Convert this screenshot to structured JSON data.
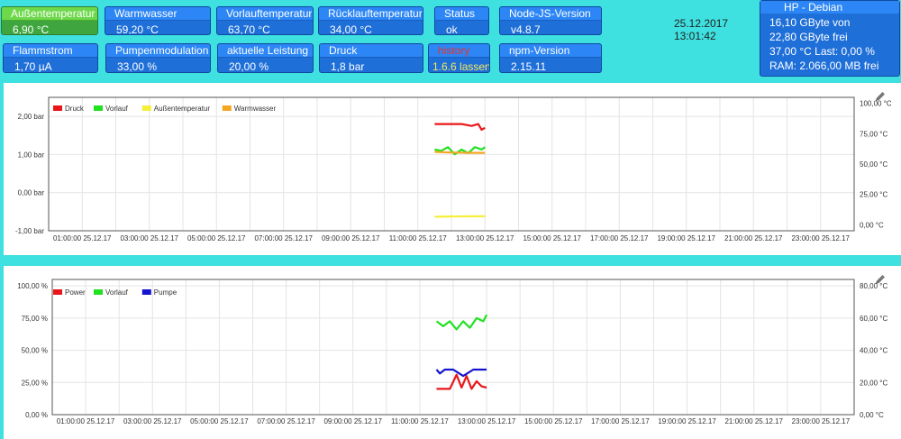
{
  "tiles": [
    {
      "id": "aussen",
      "title": "Außentemperatur",
      "value": "6,90 °C",
      "style": "green"
    },
    {
      "id": "warmwasser",
      "title": "Warmwasser",
      "value": "59,20 °C",
      "style": "blue"
    },
    {
      "id": "vorlauf",
      "title": "Vorlauftemperatur",
      "value": "63,70 °C",
      "style": "blue"
    },
    {
      "id": "ruecklauf",
      "title": "Rücklauftemperatur",
      "value": "34,00 °C",
      "style": "blue"
    },
    {
      "id": "status",
      "title": "Status",
      "value": "ok",
      "style": "blue"
    },
    {
      "id": "node",
      "title": "Node-JS-Version",
      "value": "v4.8.7",
      "style": "blue"
    },
    {
      "id": "flammstrom",
      "title": "Flammstrom",
      "value": "1,70 µA",
      "style": "blue"
    },
    {
      "id": "pumpen",
      "title": "Pumpenmodulation",
      "value": "33,00 %",
      "style": "blue"
    },
    {
      "id": "leistung",
      "title": "aktuelle Leistung",
      "value": "20,00 %",
      "style": "blue"
    },
    {
      "id": "druck",
      "title": "Druck",
      "value": "1,8 bar",
      "style": "blue"
    },
    {
      "id": "history",
      "title": "history",
      "value": "1.6.6 lassen",
      "style": "hist"
    },
    {
      "id": "npm",
      "title": "npm-Version",
      "value": "2.15.11",
      "style": "blue"
    }
  ],
  "datetime": {
    "date": "25.12.2017",
    "time": "13:01:42"
  },
  "system": {
    "title": "HP - Debian",
    "lines": [
      "16,10 GByte von",
      "22,80 GByte frei",
      "37,00 °C   Last: 0,00 %",
      "RAM: 2.066,00 MB frei"
    ]
  },
  "x_ticks": [
    "01:00:00 25.12.17",
    "03:00:00 25.12.17",
    "05:00:00 25.12.17",
    "07:00:00 25.12.17",
    "09:00:00 25.12.17",
    "11:00:00 25.12.17",
    "13:00:00 25.12.17",
    "15:00:00 25.12.17",
    "17:00:00 25.12.17",
    "19:00:00 25.12.17",
    "21:00:00 25.12.17",
    "23:00:00 25.12.17"
  ],
  "chart_data": [
    {
      "type": "line",
      "title": "",
      "x_range_hours": [
        0,
        24
      ],
      "left_axis": {
        "ticks": [
          "2,00 bar",
          "1,00 bar",
          "0,00 bar",
          "-1,00 bar"
        ],
        "min": -1,
        "max": 2.5
      },
      "right_axis": {
        "ticks": [
          "100,00 °C",
          "75,00 °C",
          "50,00 °C",
          "25,00 °C",
          "0,00 °C"
        ],
        "min": -5,
        "max": 105
      },
      "legend_position": "top-left",
      "grid": true,
      "series": [
        {
          "name": "Druck",
          "color": "#e8161a",
          "axis": "left",
          "x": [
            11.5,
            12.3,
            12.6,
            12.8,
            12.9,
            13.0
          ],
          "y": [
            1.8,
            1.8,
            1.75,
            1.8,
            1.65,
            1.7
          ]
        },
        {
          "name": "Vorlauf",
          "color": "#22e022",
          "axis": "right",
          "x": [
            11.5,
            11.7,
            11.9,
            12.1,
            12.3,
            12.5,
            12.7,
            12.9,
            13.0
          ],
          "y": [
            62,
            61,
            64,
            58,
            62,
            59,
            64,
            62,
            64
          ]
        },
        {
          "name": "Außentemperatur",
          "color": "#f5ef3a",
          "axis": "right",
          "x": [
            11.5,
            12.0,
            12.5,
            13.0
          ],
          "y": [
            6.5,
            6.8,
            6.9,
            7.0
          ]
        },
        {
          "name": "Warmwasser",
          "color": "#f5a623",
          "axis": "right",
          "x": [
            11.5,
            12.0,
            12.5,
            13.0
          ],
          "y": [
            60,
            59.5,
            59.3,
            59.2
          ]
        }
      ]
    },
    {
      "type": "line",
      "title": "",
      "x_range_hours": [
        0,
        24
      ],
      "left_axis": {
        "ticks": [
          "100,00 %",
          "75,00 %",
          "50,00 %",
          "25,00 %",
          "0,00 %"
        ],
        "min": 0,
        "max": 105
      },
      "right_axis": {
        "ticks": [
          "80,00 °C",
          "60,00 °C",
          "40,00 °C",
          "20,00 °C",
          "0,00 °C"
        ],
        "min": 0,
        "max": 84
      },
      "legend_position": "top-left",
      "grid": true,
      "series": [
        {
          "name": "Power",
          "color": "#e8161a",
          "axis": "left",
          "x": [
            11.5,
            11.9,
            12.1,
            12.25,
            12.4,
            12.55,
            12.7,
            12.85,
            13.0
          ],
          "y": [
            20,
            20,
            31,
            21,
            30,
            20,
            26,
            22,
            21
          ]
        },
        {
          "name": "Vorlauf",
          "color": "#22e022",
          "axis": "right",
          "x": [
            11.5,
            11.7,
            11.9,
            12.1,
            12.3,
            12.5,
            12.7,
            12.9,
            13.0
          ],
          "y": [
            58,
            55,
            58,
            53,
            58,
            54,
            60,
            58,
            62
          ]
        },
        {
          "name": "Pumpe",
          "color": "#1414d0",
          "axis": "left",
          "x": [
            11.5,
            11.6,
            11.75,
            12.0,
            12.3,
            12.6,
            12.8,
            13.0
          ],
          "y": [
            35,
            32,
            35,
            35,
            30,
            35,
            35,
            35
          ]
        }
      ]
    }
  ]
}
